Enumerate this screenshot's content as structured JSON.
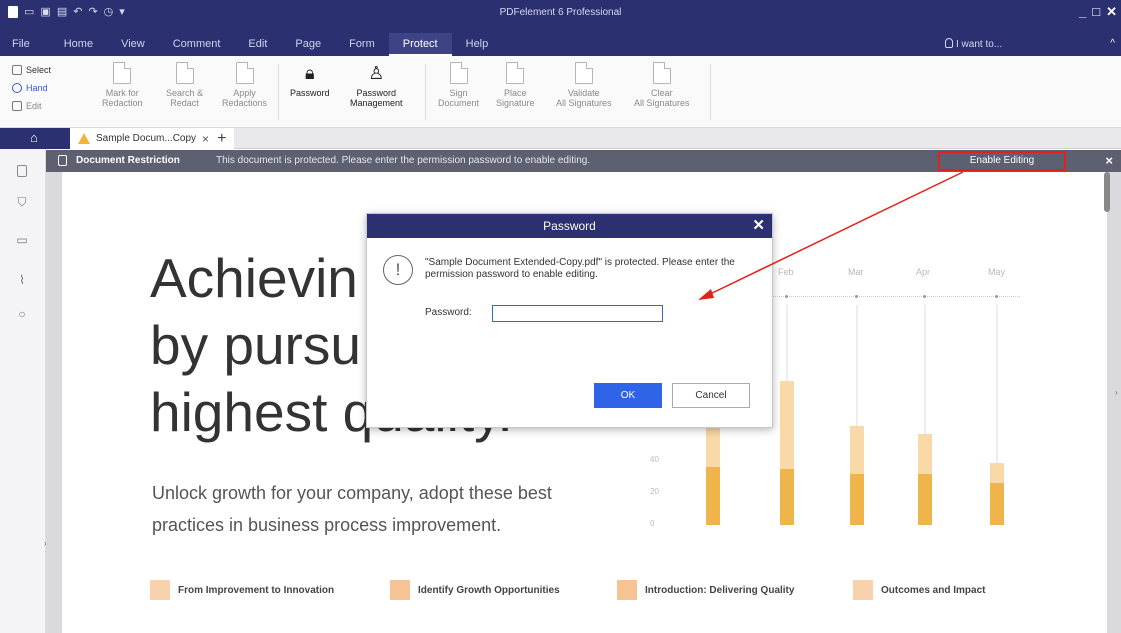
{
  "app": {
    "title": "PDFelement 6 Professional",
    "window_controls": [
      "_",
      "□",
      "✕"
    ]
  },
  "menu": {
    "items": [
      "File",
      "Home",
      "View",
      "Comment",
      "Edit",
      "Page",
      "Form",
      "Protect",
      "Help"
    ],
    "active": "Protect",
    "search_placeholder": "I want to..."
  },
  "ribbon": {
    "modes": [
      "Select",
      "Hand",
      "Edit"
    ],
    "buttons": [
      {
        "label_line1": "Mark for",
        "label_line2": "Redaction"
      },
      {
        "label_line1": "Search &",
        "label_line2": "Redact"
      },
      {
        "label_line1": "Apply",
        "label_line2": "Redactions"
      },
      {
        "label_line1": "Password",
        "label_line2": ""
      },
      {
        "label_line1": "Password",
        "label_line2": "Management"
      },
      {
        "label_line1": "Sign",
        "label_line2": "Document"
      },
      {
        "label_line1": "Place",
        "label_line2": "Signature"
      },
      {
        "label_line1": "Validate",
        "label_line2": "All Signatures"
      },
      {
        "label_line1": "Clear",
        "label_line2": "All Signatures"
      }
    ]
  },
  "tabs": {
    "document_tab": "Sample Docum...Copy",
    "close_symbol": "×",
    "add_symbol": "+"
  },
  "restriction": {
    "title": "Document Restriction",
    "message": "This document is protected. Please enter the permission password to enable editing.",
    "enable_button": "Enable Editing",
    "close_symbol": "×"
  },
  "document": {
    "headline": [
      "Achievin",
      "by pursu",
      "highest quality."
    ],
    "subtext": [
      "Unlock growth for your company, adopt these best",
      "practices in business process improvement."
    ],
    "footer_items": [
      "From Improvement to Innovation",
      "Identify Growth Opportunities",
      "Introduction: Delivering Quality",
      "Outcomes and Impact"
    ]
  },
  "chart_data": {
    "type": "bar",
    "categories": [
      "Feb",
      "Mar",
      "Apr",
      "May"
    ],
    "series": [
      {
        "values": [
          90,
          62,
          57,
          39
        ]
      },
      {
        "values": [
          35,
          32,
          32,
          26
        ]
      }
    ],
    "y_ticks": [
      "40",
      "20",
      "0"
    ],
    "ylim": [
      0,
      170
    ],
    "colors": [
      "#f8d9a7",
      "#f0b54a"
    ]
  },
  "dialog": {
    "title": "Password",
    "message": "\"Sample Document Extended-Copy.pdf\" is protected. Please enter the permission password to enable editing.",
    "password_label": "Password:",
    "password_value": "",
    "ok_label": "OK",
    "cancel_label": "Cancel",
    "close_symbol": "✕"
  },
  "colors": {
    "title_bar": "#2b3070",
    "highlight_red": "#e0221b",
    "ok_button": "#2f63e8"
  }
}
